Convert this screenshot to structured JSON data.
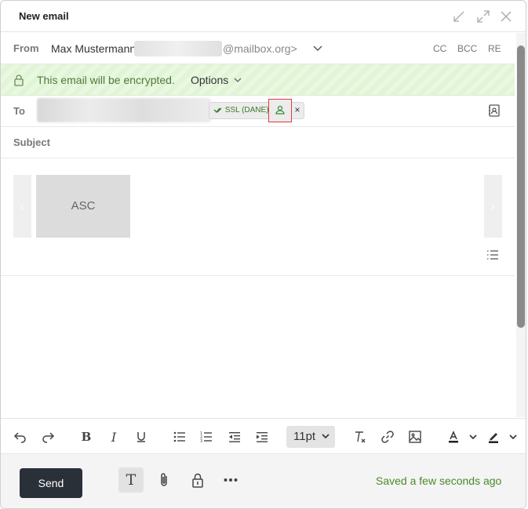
{
  "window": {
    "title": "New email"
  },
  "from": {
    "label": "From",
    "name": "Max Mustermann",
    "domain": "@mailbox.org>",
    "links": [
      "CC",
      "BCC",
      "RE"
    ]
  },
  "encryption": {
    "message": "This email will be encrypted.",
    "options_label": "Options"
  },
  "to": {
    "label": "To",
    "chip_ssl": "SSL (DANE)",
    "chip_remove": "×"
  },
  "subject": {
    "label": "Subject"
  },
  "attachment": {
    "preview_label": "ASC"
  },
  "toolbar": {
    "font_size": "11pt"
  },
  "footer": {
    "send_label": "Send",
    "status": "Saved a few seconds ago"
  },
  "colors": {
    "encrypted_bg": "#e9f8e0",
    "send_button": "#2a3038",
    "status_green": "#4a8a2a",
    "highlight_box": "#e03b3b"
  }
}
